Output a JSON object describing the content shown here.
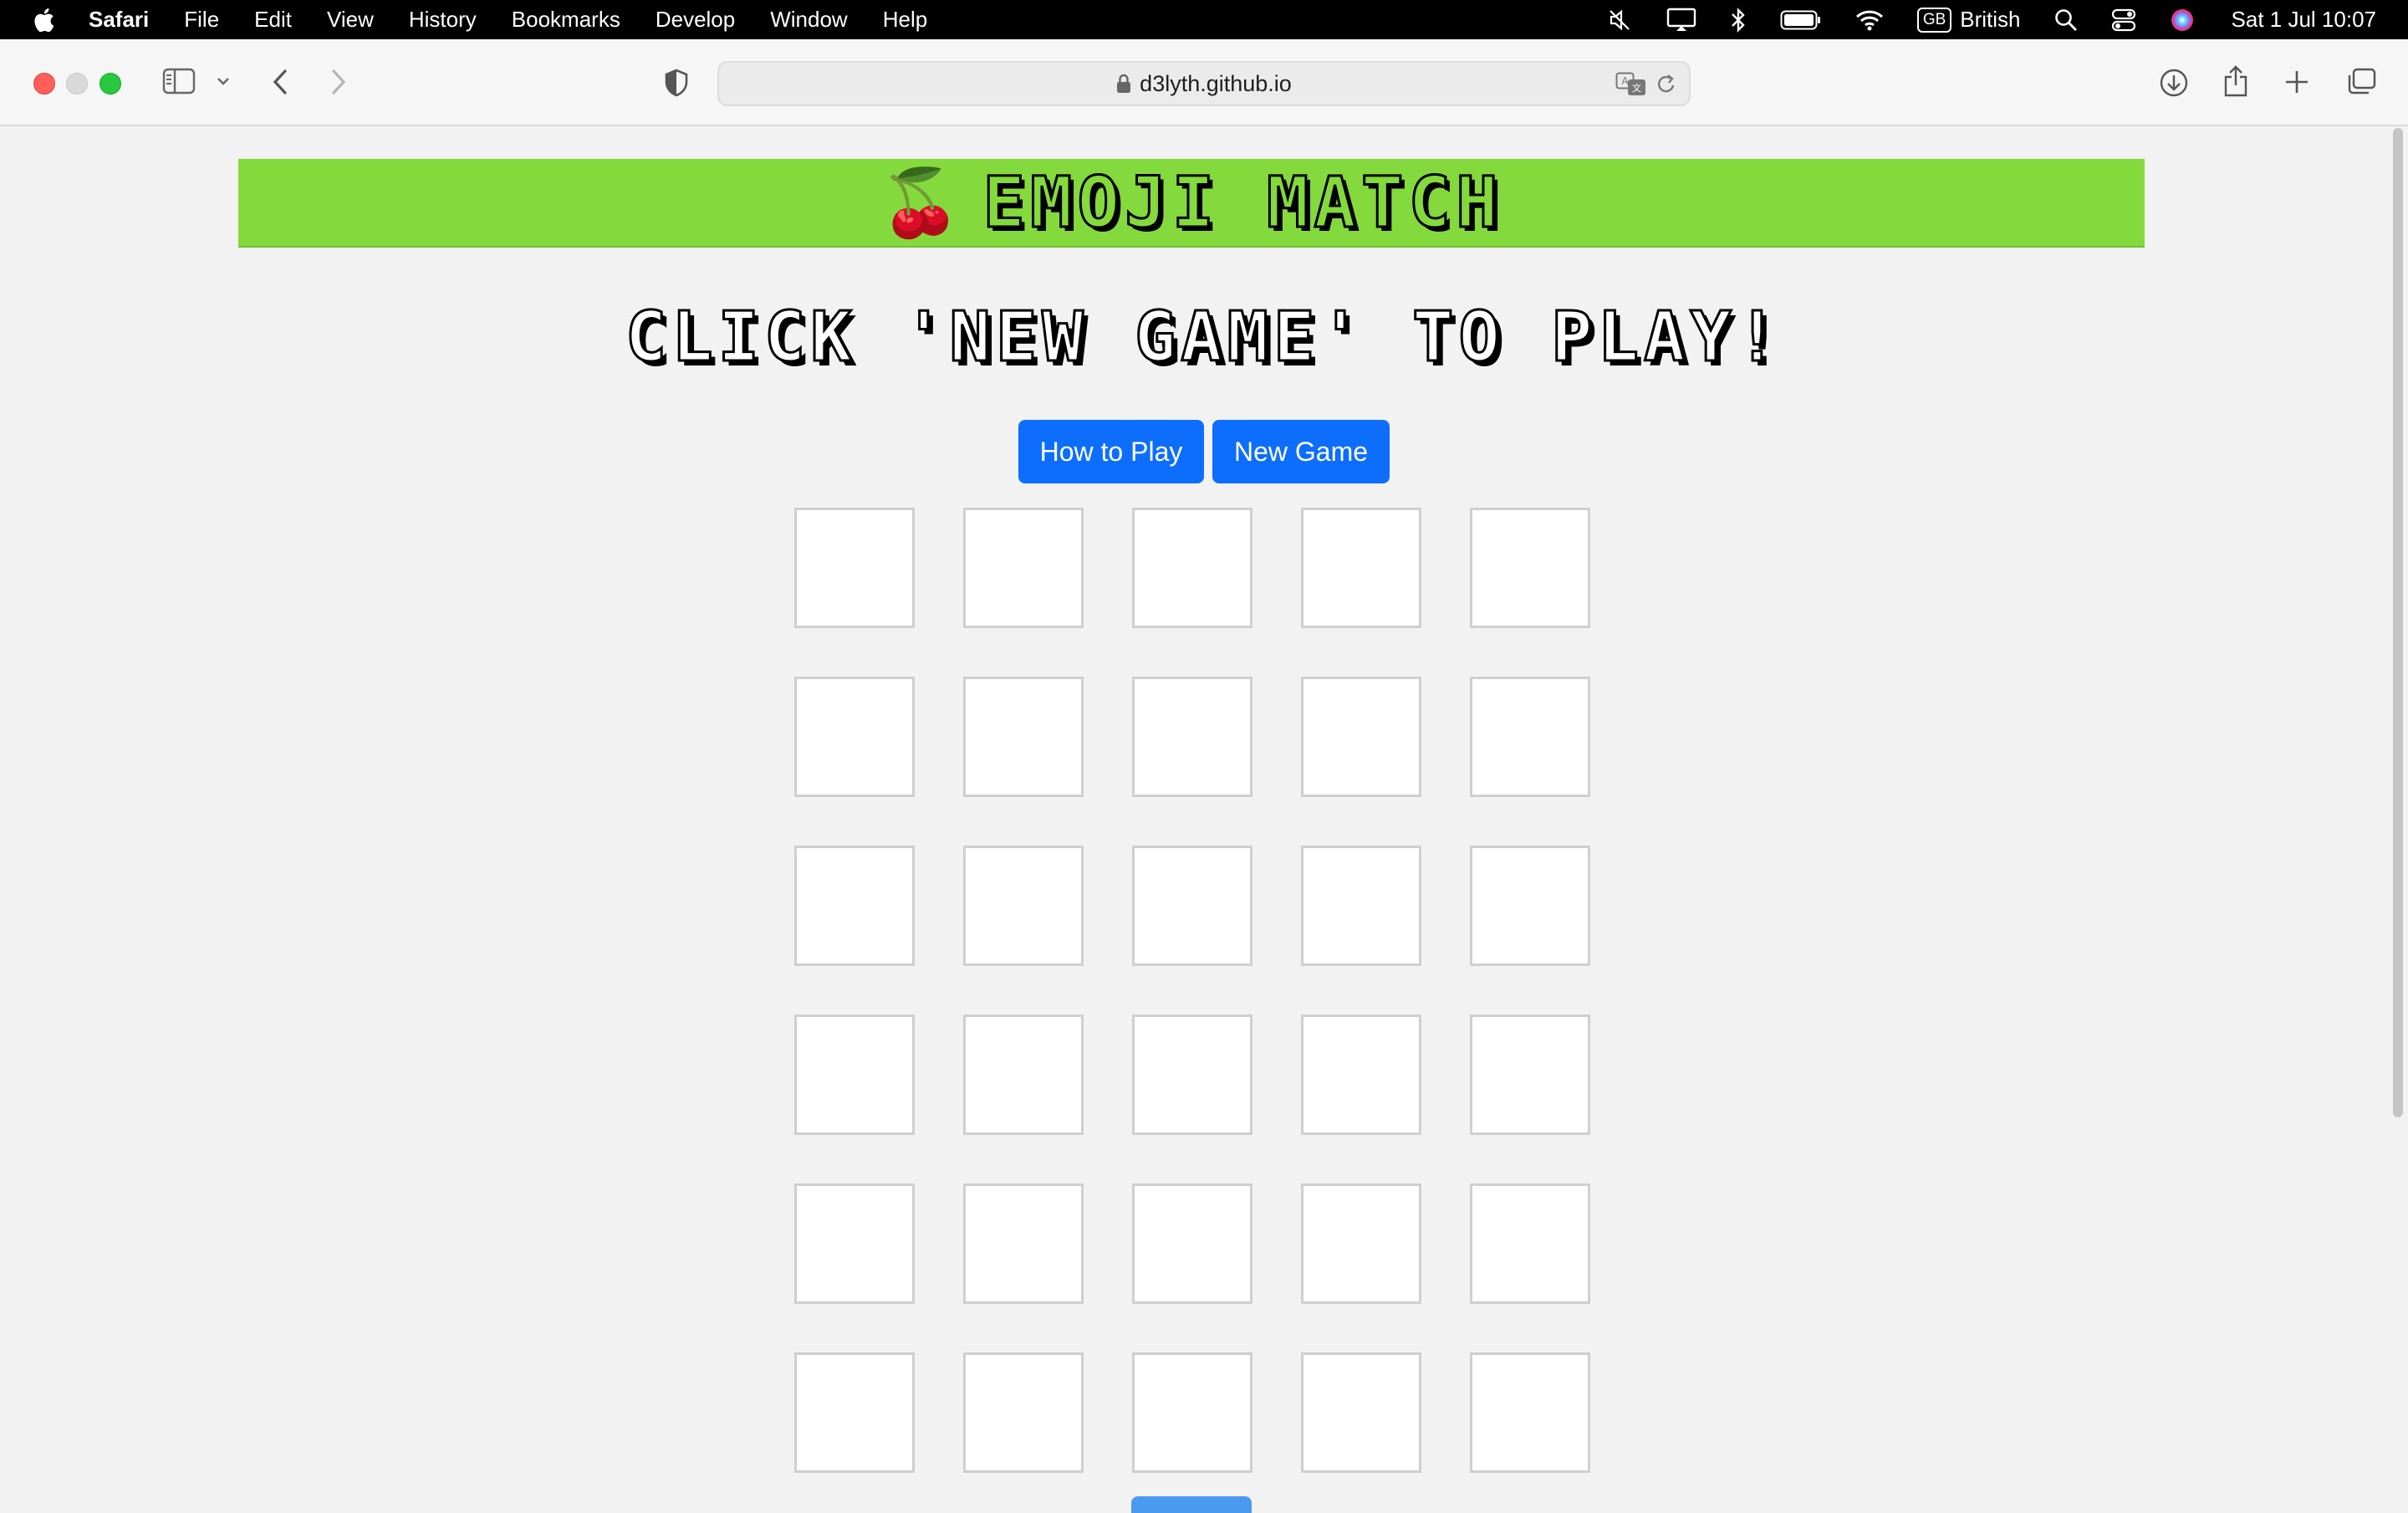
{
  "menubar": {
    "app_name": "Safari",
    "items": [
      "File",
      "Edit",
      "View",
      "History",
      "Bookmarks",
      "Develop",
      "Window",
      "Help"
    ],
    "input_source_badge": "GB",
    "input_source_label": "British",
    "clock": "Sat 1 Jul  10:07"
  },
  "browser": {
    "url": "d3lyth.github.io"
  },
  "game": {
    "banner_emoji": "🍒",
    "title": "EMOJI MATCH",
    "status": "CLICK 'NEW GAME' TO PLAY!",
    "buttons": {
      "how_to_play": "How to Play",
      "new_game": "New Game"
    },
    "grid": {
      "rows": 6,
      "columns": 5,
      "cards": [
        "",
        "",
        "",
        "",
        "",
        "",
        "",
        "",
        "",
        "",
        "",
        "",
        "",
        "",
        "",
        "",
        "",
        "",
        "",
        "",
        "",
        "",
        "",
        "",
        "",
        "",
        "",
        "",
        "",
        ""
      ]
    }
  },
  "colors": {
    "banner_bg": "#84d93c",
    "button_bg": "#0d6efd",
    "page_bg": "#f2f2f2"
  }
}
